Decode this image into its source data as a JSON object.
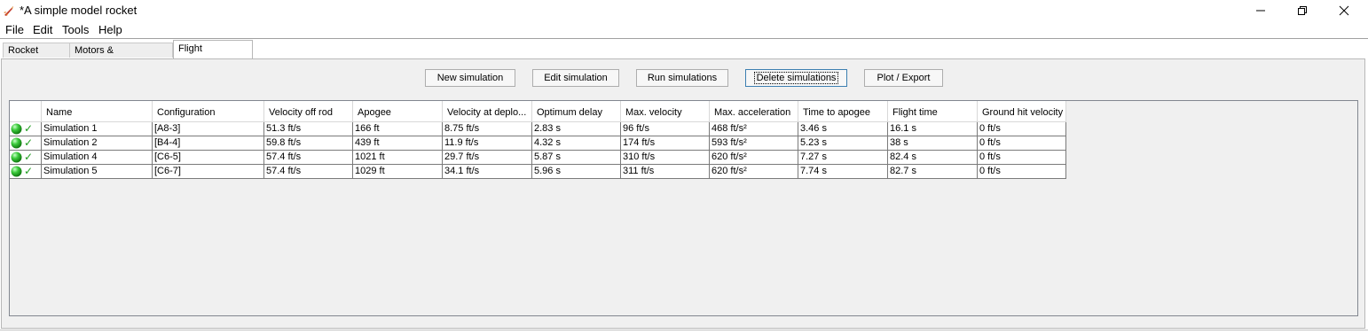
{
  "window": {
    "title": "*A simple model rocket",
    "app_icon": "rocket-icon",
    "controls": [
      "minimize-icon",
      "restore-icon",
      "close-icon"
    ]
  },
  "menubar": {
    "items": [
      "File",
      "Edit",
      "Tools",
      "Help"
    ]
  },
  "tabs": [
    {
      "label": "Rocket design",
      "active": false
    },
    {
      "label": "Motors & Configuration",
      "active": false
    },
    {
      "label": "Flight simulations",
      "active": true
    }
  ],
  "toolbar": {
    "new_simulation": "New simulation",
    "edit_simulation": "Edit simulation",
    "run_simulations": "Run simulations",
    "delete_simulations": "Delete simulations",
    "plot_export": "Plot / Export"
  },
  "table": {
    "columns": [
      "",
      "Name",
      "Configuration",
      "Velocity off rod",
      "Apogee",
      "Velocity at deplo...",
      "Optimum delay",
      "Max. velocity",
      "Max. acceleration",
      "Time to apogee",
      "Flight time",
      "Ground hit velocity"
    ],
    "rows": [
      {
        "status": "green-ball-icon",
        "check": "✓",
        "name": "Simulation 1",
        "configuration": "[A8-3]",
        "velocity_off_rod": "51.3 ft/s",
        "apogee": "166 ft",
        "velocity_at_deploy": "8.75 ft/s",
        "optimum_delay": "2.83 s",
        "max_velocity": "96 ft/s",
        "max_acceleration": "468 ft/s²",
        "time_to_apogee": "3.46 s",
        "flight_time": "16.1 s",
        "ground_hit_velocity": "0 ft/s"
      },
      {
        "status": "green-ball-icon",
        "check": "✓",
        "name": "Simulation 2",
        "configuration": "[B4-4]",
        "velocity_off_rod": "59.8 ft/s",
        "apogee": "439 ft",
        "velocity_at_deploy": "11.9 ft/s",
        "optimum_delay": "4.32 s",
        "max_velocity": "174 ft/s",
        "max_acceleration": "593 ft/s²",
        "time_to_apogee": "5.23 s",
        "flight_time": "38 s",
        "ground_hit_velocity": "0 ft/s"
      },
      {
        "status": "green-ball-icon",
        "check": "✓",
        "name": "Simulation 4",
        "configuration": "[C6-5]",
        "velocity_off_rod": "57.4 ft/s",
        "apogee": "1021 ft",
        "velocity_at_deploy": "29.7 ft/s",
        "optimum_delay": "5.87 s",
        "max_velocity": "310 ft/s",
        "max_acceleration": "620 ft/s²",
        "time_to_apogee": "7.27 s",
        "flight_time": "82.4 s",
        "ground_hit_velocity": "0 ft/s"
      },
      {
        "status": "green-ball-icon",
        "check": "✓",
        "name": "Simulation 5",
        "configuration": "[C6-7]",
        "velocity_off_rod": "57.4 ft/s",
        "apogee": "1029 ft",
        "velocity_at_deploy": "34.1 ft/s",
        "optimum_delay": "5.96 s",
        "max_velocity": "311 ft/s",
        "max_acceleration": "620 ft/s²",
        "time_to_apogee": "7.74 s",
        "flight_time": "82.7 s",
        "ground_hit_velocity": "0 ft/s"
      }
    ]
  },
  "colors": {
    "status_green": "#2fb52f",
    "check_green": "#1f9d1f",
    "focus_border": "#3c7fb1"
  }
}
